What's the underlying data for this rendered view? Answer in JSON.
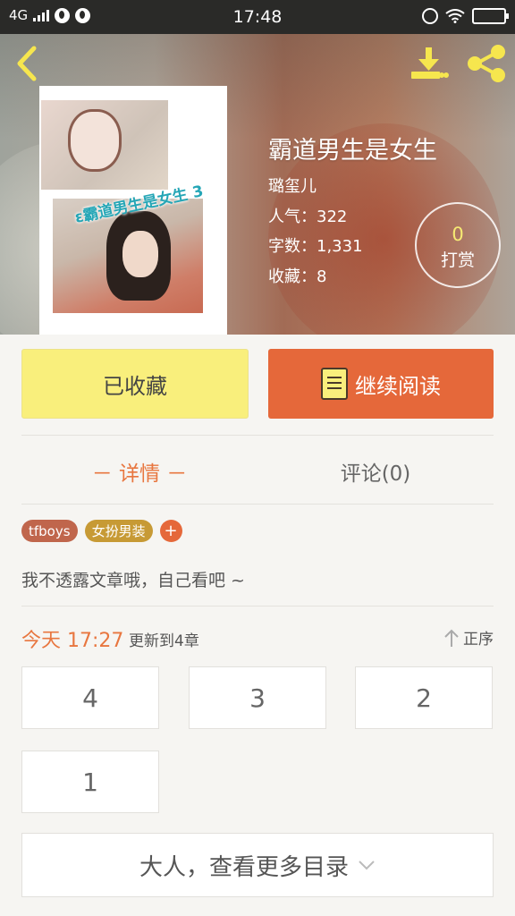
{
  "status_bar": {
    "network": "4G",
    "time": "17:48"
  },
  "book": {
    "title": "霸道男生是女生",
    "cover_title": "ε霸道男生是女生 3",
    "author": "璐玺儿",
    "popularity": "人气：322",
    "word_count": "字数：1,331",
    "favorites": "收藏：8"
  },
  "reward": {
    "count": "0",
    "label": "打赏"
  },
  "actions": {
    "collected_label": "已收藏",
    "read_label": "继续阅读"
  },
  "tabs": [
    {
      "label": "－ 详情 －",
      "active": true
    },
    {
      "label": "评论(0)",
      "active": false
    }
  ],
  "tags": [
    {
      "label": "tfboys",
      "color": "#c0664c"
    },
    {
      "label": "女扮男装",
      "color": "#c79a35"
    }
  ],
  "tag_add_label": "+",
  "description": "我不透露文章哦，自己看吧 ~",
  "update": {
    "time": "今天 17:27",
    "text": "更新到4章"
  },
  "sort_label": "正序",
  "chapters": [
    "4",
    "3",
    "2",
    "1"
  ],
  "more_catalog_label": "大人，查看更多目录",
  "colors": {
    "accent": "#e8763f",
    "primary_button": "#e5683a",
    "collected_button": "#f9ef7c",
    "icon_yellow": "#f6ea73"
  }
}
